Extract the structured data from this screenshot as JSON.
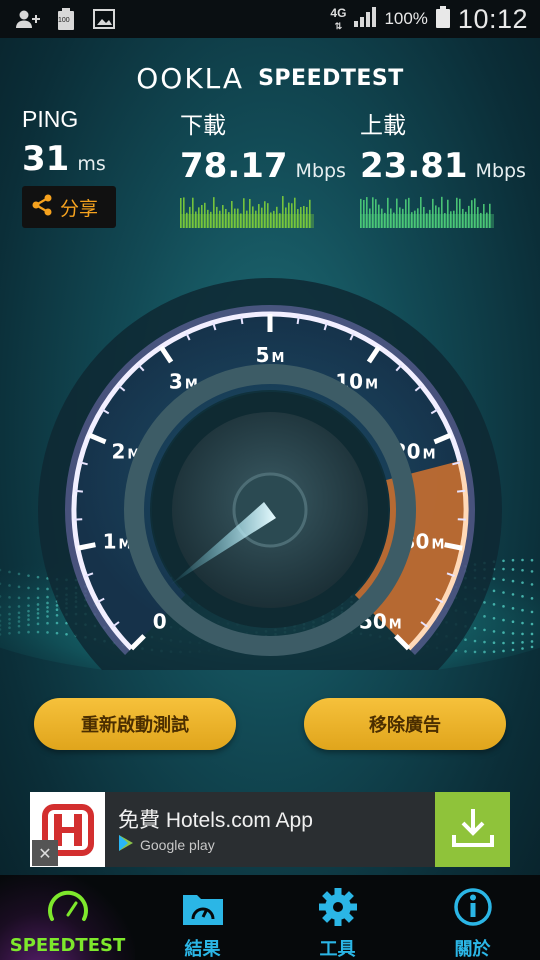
{
  "status_bar": {
    "battery_label": "100",
    "network": "4G",
    "battery_percent": "100%",
    "time": "10:12"
  },
  "header": {
    "logo": "OOKLA",
    "title": "SPEEDTEST"
  },
  "metrics": {
    "ping": {
      "label": "PING",
      "value": "31",
      "unit": "ms"
    },
    "download": {
      "label": "下載",
      "value": "78.17",
      "unit": "Mbps"
    },
    "upload": {
      "label": "上載",
      "value": "23.81",
      "unit": "Mbps"
    }
  },
  "share": {
    "label": "分享"
  },
  "gauge": {
    "ticks": [
      {
        "num": "0",
        "unit": ""
      },
      {
        "num": "1",
        "unit": "M"
      },
      {
        "num": "2",
        "unit": "M"
      },
      {
        "num": "3",
        "unit": "M"
      },
      {
        "num": "5",
        "unit": "M"
      },
      {
        "num": "10",
        "unit": "M"
      },
      {
        "num": "20",
        "unit": "M"
      },
      {
        "num": "30",
        "unit": "M"
      },
      {
        "num": "50",
        "unit": "M"
      }
    ],
    "needle_value_fraction": 0.03
  },
  "buttons": {
    "restart": "重新啟動測試",
    "remove_ads": "移除廣告"
  },
  "ad": {
    "title": "免費 Hotels.com App",
    "store": "Google play",
    "close": "✕",
    "logo_letter": "H"
  },
  "nav": {
    "items": [
      {
        "label": "SPEEDTEST",
        "icon": "speedometer-icon",
        "active": true
      },
      {
        "label": "結果",
        "icon": "folder-gauge-icon",
        "active": false
      },
      {
        "label": "工具",
        "icon": "gear-icon",
        "active": false
      },
      {
        "label": "關於",
        "icon": "info-icon",
        "active": false
      }
    ]
  },
  "colors": {
    "accent_orange": "#f6a21e",
    "button_gold": "#f0b52c",
    "nav_blue": "#2bb6e6",
    "nav_active_green": "#7ee82c",
    "gauge_purple": "#8a6fe0",
    "gauge_orange": "#e8883a",
    "download_bar": "#7ecf3a",
    "upload_bar": "#4fd07a"
  }
}
